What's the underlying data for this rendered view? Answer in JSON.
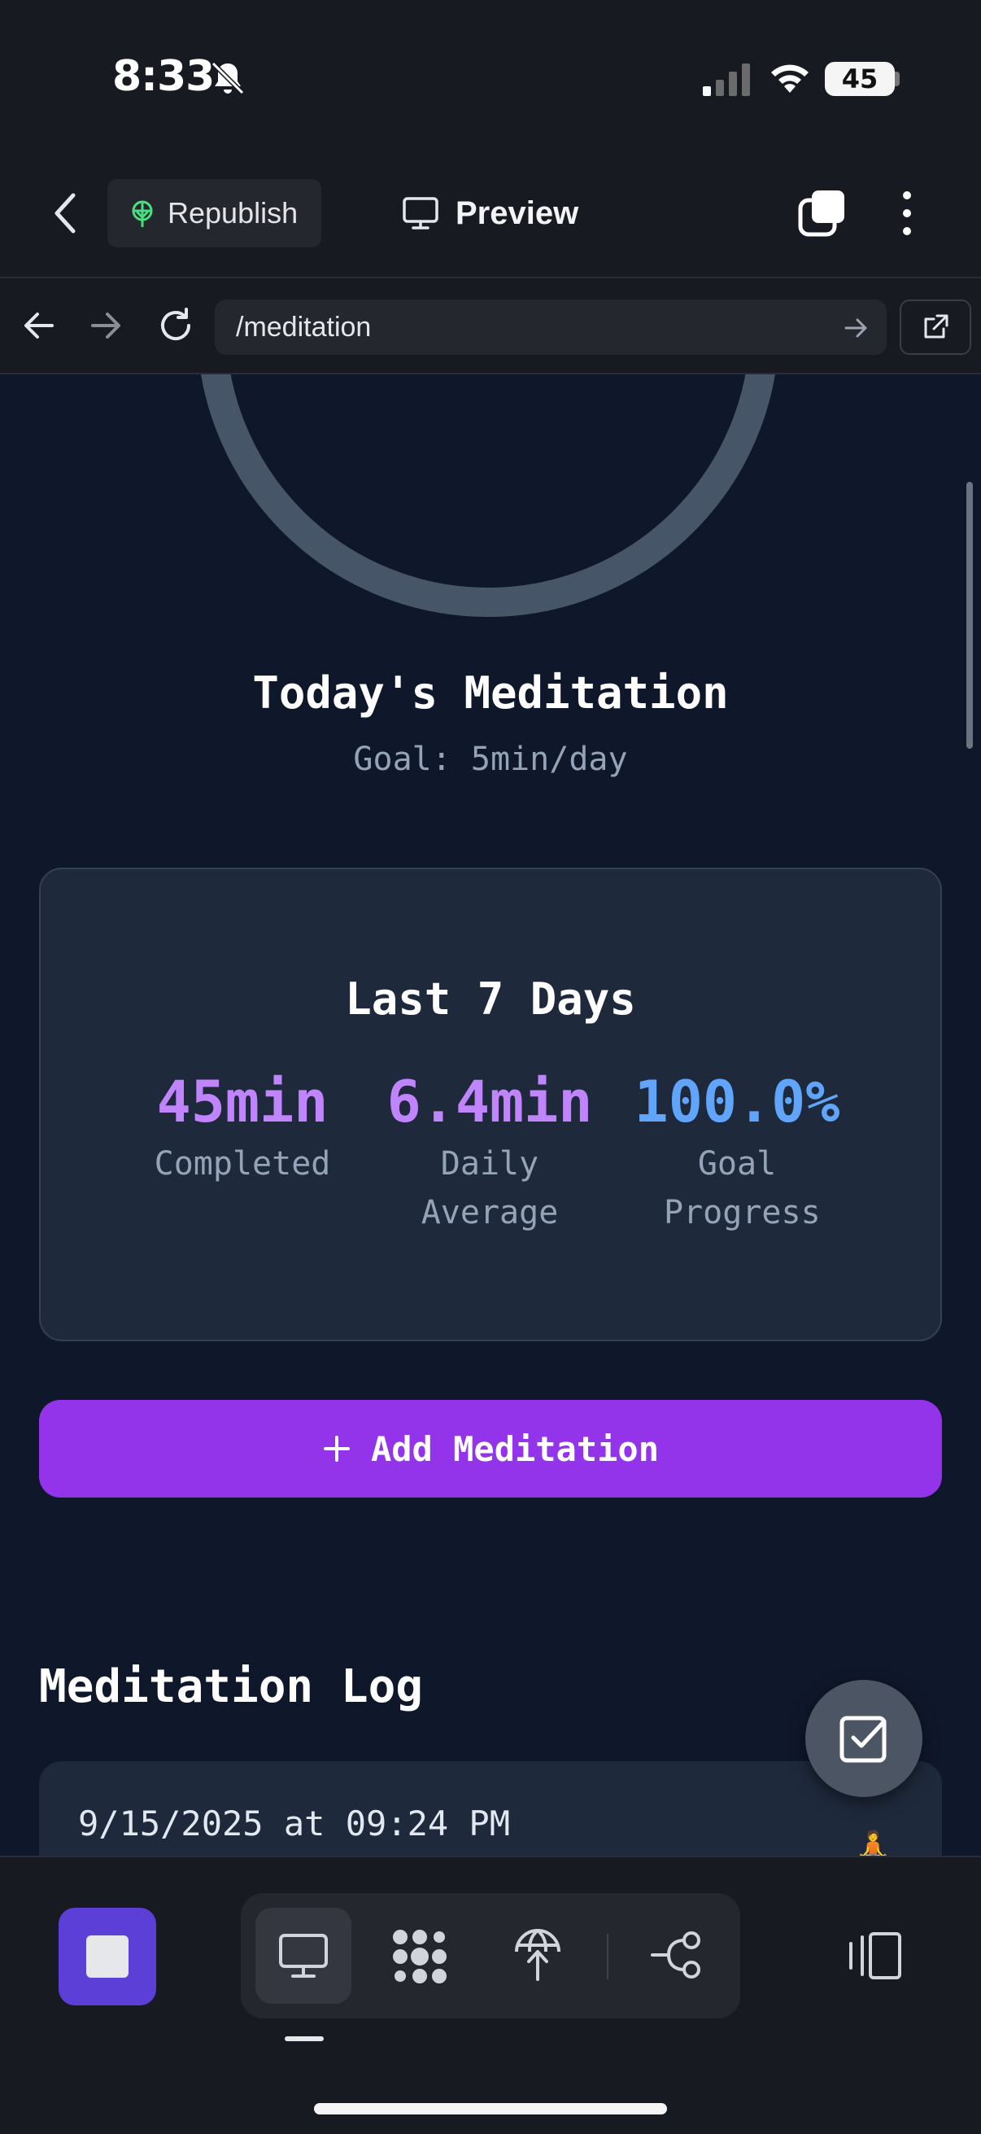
{
  "status_bar": {
    "time": "8:33",
    "battery": "45"
  },
  "header": {
    "republish_label": "Republish",
    "preview_label": "Preview"
  },
  "address_bar": {
    "url": "/meditation"
  },
  "today": {
    "title": "Today's Meditation",
    "goal": "Goal: 5min/day"
  },
  "stats_card": {
    "title": "Last 7 Days",
    "stats": [
      {
        "value": "45min",
        "label": "Completed",
        "color": "#c084fc"
      },
      {
        "value": "6.4min",
        "label": "Daily Average",
        "color": "#c084fc"
      },
      {
        "value": "100.0%",
        "label": "Goal Progress",
        "color": "#60a5fa"
      }
    ]
  },
  "add_button": {
    "label": "Add Meditation"
  },
  "log": {
    "title": "Meditation Log",
    "entries": [
      {
        "date": "9/15/2025 at 09:24 PM",
        "emoji": "🧘"
      }
    ]
  },
  "colors": {
    "accent": "#9333ea",
    "stop_button": "#5b3fd6",
    "ring": "#475569"
  },
  "icons": [
    "bell-slash-icon",
    "signal-icon",
    "wifi-icon",
    "back-chevron-icon",
    "republish-icon",
    "monitor-icon",
    "tabs-icon",
    "kebab-icon",
    "arrow-left-icon",
    "arrow-right-icon",
    "reload-icon",
    "external-link-icon",
    "plus-icon",
    "checklist-icon",
    "stop-icon",
    "desktop-icon",
    "dots-grid-icon",
    "globe-upload-icon",
    "flow-icon",
    "panels-icon"
  ]
}
